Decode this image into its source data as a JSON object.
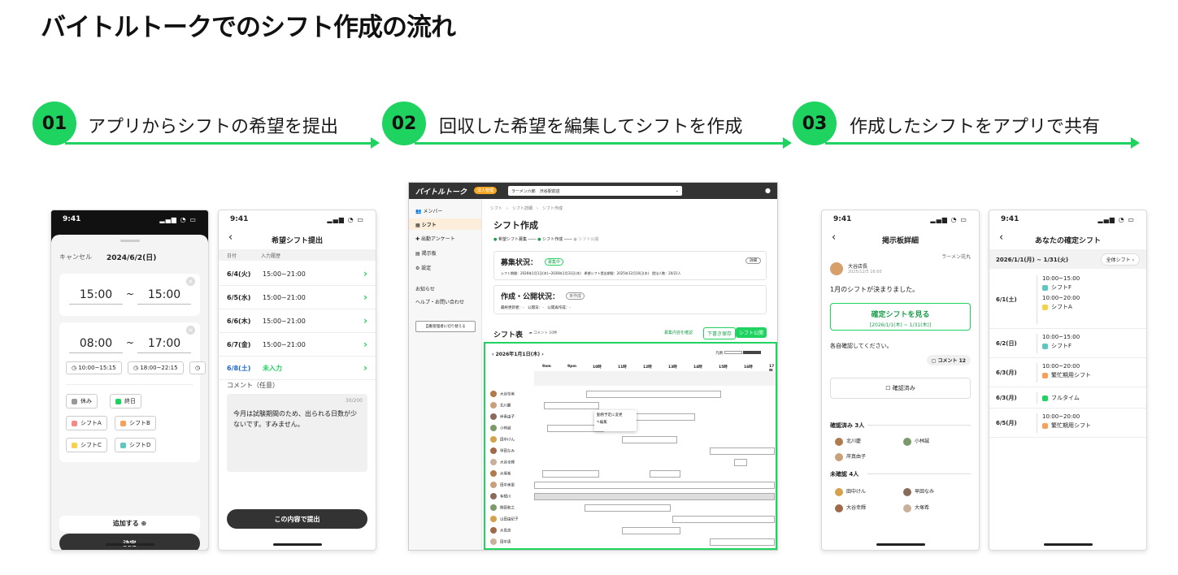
{
  "title": "バイトルトークでのシフト作成の流れ",
  "steps": [
    {
      "num": "01",
      "label": "アプリからシフトの希望を提出"
    },
    {
      "num": "02",
      "label": "回収した希望を編集してシフトを作成"
    },
    {
      "num": "03",
      "label": "作成したシフトをアプリで共有"
    }
  ],
  "colors": {
    "accent": "#1ed35f",
    "dark": "#333333"
  },
  "phone1": {
    "time": "9:41",
    "cancel": "キャンセル",
    "date": "2024/6/2(日)",
    "range1": {
      "start": "15:00",
      "sep": "~",
      "end": "15:00"
    },
    "range2": {
      "start": "08:00",
      "sep": "~",
      "end": "17:00"
    },
    "presets": [
      "10:00~15:15",
      "18:00~22:15"
    ],
    "chips": [
      "休み",
      "終日",
      "シフトA",
      "シフトB",
      "シフトC",
      "シフトD"
    ],
    "add": "追加する",
    "submit": "決定"
  },
  "phone2": {
    "time": "9:41",
    "header": "希望シフト提出",
    "col_date": "日付",
    "col_input": "入力履歴",
    "rows": [
      {
        "date": "6/4(火)",
        "value": "15:00~21:00"
      },
      {
        "date": "6/5(水)",
        "value": "15:00~21:00"
      },
      {
        "date": "6/6(木)",
        "value": "15:00~21:00"
      },
      {
        "date": "6/7(金)",
        "value": "15:00~21:00"
      },
      {
        "date": "6/8(土)",
        "value": "未入力"
      }
    ],
    "comment_label": "コメント（任意）",
    "counter": "30/200",
    "comment": "今月は試験期間のため、出られる日数が少ないです。すみません。",
    "submit": "この内容で提出"
  },
  "web": {
    "logo": "バイトルトーク",
    "badge": "法人管理",
    "store": "ラーメン六郎　渋谷駅前店",
    "nav": [
      "メンバー",
      "シフト",
      "出勤アンケート",
      "掲示板",
      "設定"
    ],
    "nav_bottom": [
      "お知らせ",
      "ヘルプ・お問い合わせ"
    ],
    "switch": "自動管理者に切り替える",
    "breadcrumb": "シフト　›　シフト詳細　›　シフト作成",
    "page_title": "シフト作成",
    "progress": [
      "希望シフト募集",
      "シフト作成",
      "シフト公開"
    ],
    "recruit_title": "募集状況：",
    "recruit_badge": "募集中",
    "recruit_info": "シフト期間：2026年1月1日(木)~2026年1月31日(木)　希望シフト提出期限：2025年12月10日(木)　提出人数：20/21人",
    "recruit_btn": "詳細",
    "create_title": "作成・公開状況：",
    "create_badge": "未作成",
    "create_info": "最終更新者：-　公開日：-　公開再作成：-",
    "table_title": "シフト表",
    "comment_count": "コメント 10件",
    "link": "募集内容を確認",
    "btn_draft": "下書き保存",
    "btn_publish": "シフト公開",
    "table_date": "2026年1月1日(木)",
    "legend": "凡例",
    "hours": [
      "9am",
      "9pm",
      "10時",
      "11時",
      "12時",
      "13時",
      "14時",
      "15時",
      "16時",
      "17時"
    ],
    "members": [
      "大谷奈美",
      "北川慶",
      "岸真由子",
      "小林誠",
      "田中けん",
      "早田なみ",
      "大谷幸輝",
      "大塚希",
      "田中美里",
      "有栖川",
      "関田和之",
      "山田由紀子",
      "大島良",
      "田中恵"
    ],
    "popup": [
      "勤務予定に変更",
      "編集"
    ]
  },
  "phone3": {
    "time": "9:41",
    "header": "掲示板詳細",
    "shop": "ラーメン花丸",
    "poster": "大谷店長",
    "posted": "2025/12/5 16:00",
    "message": "1月のシフトが決まりました。",
    "card_title": "確定シフトを見る",
    "card_range": "[2026/1/1(木) ~ 1/31(木)]",
    "note": "各自確認してください。",
    "comment_btn": "コメント 12",
    "confirm": "確認済み",
    "confirmed_label": "確認済み 3人",
    "confirmed": [
      "北川慶",
      "小林誠",
      "岸真由子"
    ],
    "unconfirmed_label": "未確認 4人",
    "unconfirmed": [
      "田中けん",
      "早田なみ",
      "大谷幸輝",
      "大塚希"
    ]
  },
  "phone4": {
    "time": "9:41",
    "header": "あなたの確定シフト",
    "period": "2026/1/1(月) ~ 1/31(火)",
    "all_btn": "全体シフト",
    "days": [
      {
        "date": "6/1(土)",
        "entries": [
          {
            "time": "10:00~15:00",
            "name": "シフトF",
            "color": "#5ec7c0"
          },
          {
            "time": "10:00~20:00",
            "name": "シフトA",
            "color": "#f5d24a"
          }
        ]
      },
      {
        "date": "6/2(日)",
        "entries": [
          {
            "time": "10:00~15:00",
            "name": "シフトF",
            "color": "#5ec7c0"
          }
        ]
      },
      {
        "date": "6/3(月)",
        "entries": [
          {
            "time": "10:00~20:00",
            "name": "繁忙期用シフト",
            "color": "#f5a15c"
          }
        ]
      },
      {
        "date": "6/3(月)",
        "entries": [
          {
            "time": "",
            "name": "フルタイム",
            "color": "#1ed35f"
          }
        ]
      },
      {
        "date": "6/5(月)",
        "entries": [
          {
            "time": "10:00~20:00",
            "name": "繁忙期用シフト",
            "color": "#f5a15c"
          }
        ]
      }
    ]
  }
}
